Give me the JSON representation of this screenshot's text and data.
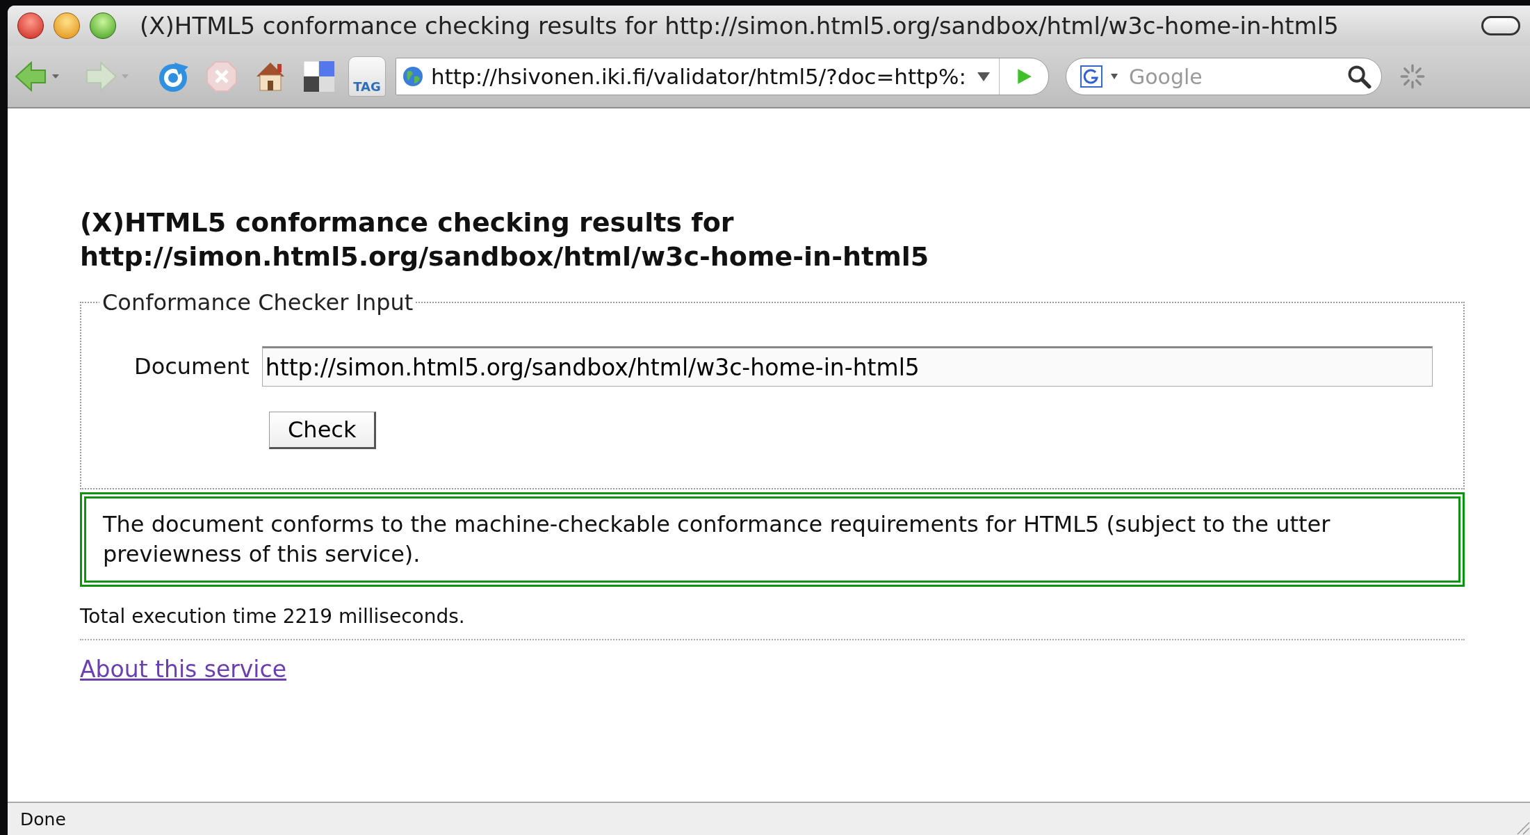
{
  "window": {
    "title": "(X)HTML5 conformance checking results for http://simon.html5.org/sandbox/html/w3c-home-in-html5"
  },
  "toolbar": {
    "address": "http://hsivonen.iki.fi/validator/html5/?doc=http%:",
    "search": {
      "placeholder": "Google"
    },
    "tag_label": "TAG"
  },
  "page": {
    "heading": "(X)HTML5 conformance checking results for",
    "heading_url": "http://simon.html5.org/sandbox/html/w3c-home-in-html5",
    "fieldset": {
      "legend": "Conformance Checker Input",
      "field_label": "Document",
      "field_value": "http://simon.html5.org/sandbox/html/w3c-home-in-html5",
      "button": "Check"
    },
    "result": "The document conforms to the machine-checkable conformance requirements for HTML5 (subject to the utter previewness of this service).",
    "timing": "Total execution time 2219 milliseconds.",
    "link": "About this service"
  },
  "status_bar": "Done"
}
